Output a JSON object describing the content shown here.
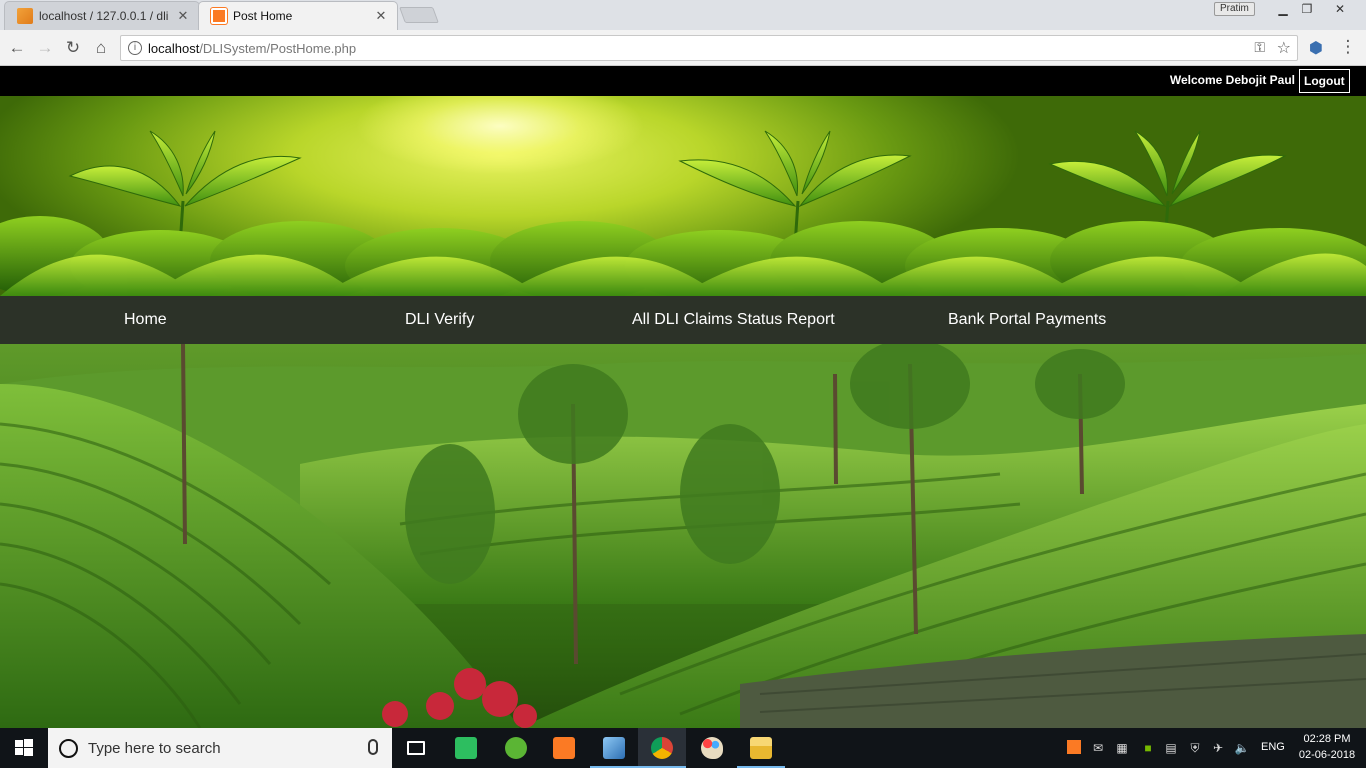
{
  "browser": {
    "tabs": [
      {
        "title": "localhost / 127.0.0.1 / dli",
        "active": false,
        "favicon": "phpmyadmin-icon"
      },
      {
        "title": "Post Home",
        "active": true,
        "favicon": "xampp-icon"
      }
    ],
    "profile_name": "Pratim",
    "url_host": "localhost",
    "url_path": "/DLISystem/PostHome.php"
  },
  "page": {
    "welcome_text": "Welcome Debojit Paul",
    "logout_label": "Logout",
    "nav": [
      {
        "label": "Home"
      },
      {
        "label": "DLI Verify"
      },
      {
        "label": "All DLI Claims Status Report"
      },
      {
        "label": "Bank Portal Payments"
      }
    ]
  },
  "taskbar": {
    "search_placeholder": "Type here to search",
    "language": "ENG",
    "time": "02:28 PM",
    "date": "02-06-2018",
    "pinned": [
      "task-view-icon",
      "evernote-icon",
      "utorrent-icon",
      "xampp-icon",
      "virtualbox-icon",
      "chrome-icon",
      "paint-icon",
      "file-explorer-icon"
    ]
  },
  "colors": {
    "page_topbar": "#000000",
    "navbar": "#1c2318",
    "taskbar": "#101418",
    "accent": "#76b9ed"
  }
}
